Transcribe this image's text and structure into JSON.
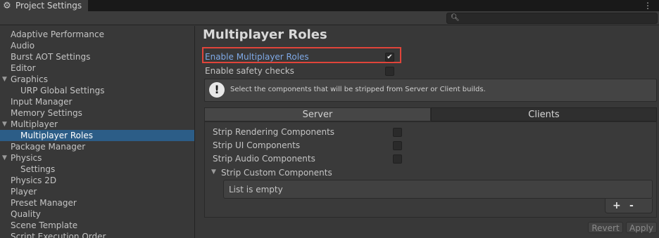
{
  "window": {
    "tab_title": "Project Settings",
    "tab_icon": "gear-icon",
    "menu_icon": "kebab-menu-icon"
  },
  "search": {
    "icon": "search-icon",
    "placeholder": ""
  },
  "sidebar": {
    "items": [
      {
        "label": "Adaptive Performance"
      },
      {
        "label": "Audio"
      },
      {
        "label": "Burst AOT Settings"
      },
      {
        "label": "Editor"
      },
      {
        "label": "Graphics"
      },
      {
        "label": "URP Global Settings"
      },
      {
        "label": "Input Manager"
      },
      {
        "label": "Memory Settings"
      },
      {
        "label": "Multiplayer"
      },
      {
        "label": "Multiplayer Roles"
      },
      {
        "label": "Package Manager"
      },
      {
        "label": "Physics"
      },
      {
        "label": "Settings"
      },
      {
        "label": "Physics 2D"
      },
      {
        "label": "Player"
      },
      {
        "label": "Preset Manager"
      },
      {
        "label": "Quality"
      },
      {
        "label": "Scene Template"
      },
      {
        "label": "Script Execution Order"
      }
    ]
  },
  "main": {
    "title": "Multiplayer Roles",
    "enable_roles_label": "Enable Multiplayer Roles",
    "enable_roles_checked": true,
    "safety_label": "Enable safety checks",
    "safety_checked": false,
    "info_text": "Select the components that will be stripped from Server or Client builds.",
    "tabs": [
      {
        "label": "Server"
      },
      {
        "label": "Clients"
      }
    ],
    "strip_rendering": "Strip Rendering Components",
    "strip_ui": "Strip UI Components",
    "strip_audio": "Strip Audio Components",
    "strip_custom": "Strip Custom Components",
    "list_empty": "List is empty",
    "add_symbol": "+",
    "remove_symbol": "-"
  },
  "footer": {
    "revert": "Revert",
    "apply": "Apply"
  },
  "colors": {
    "selection": "#2c5d87",
    "highlight_border": "#e0443a",
    "link_blue": "#7fa9e6"
  }
}
